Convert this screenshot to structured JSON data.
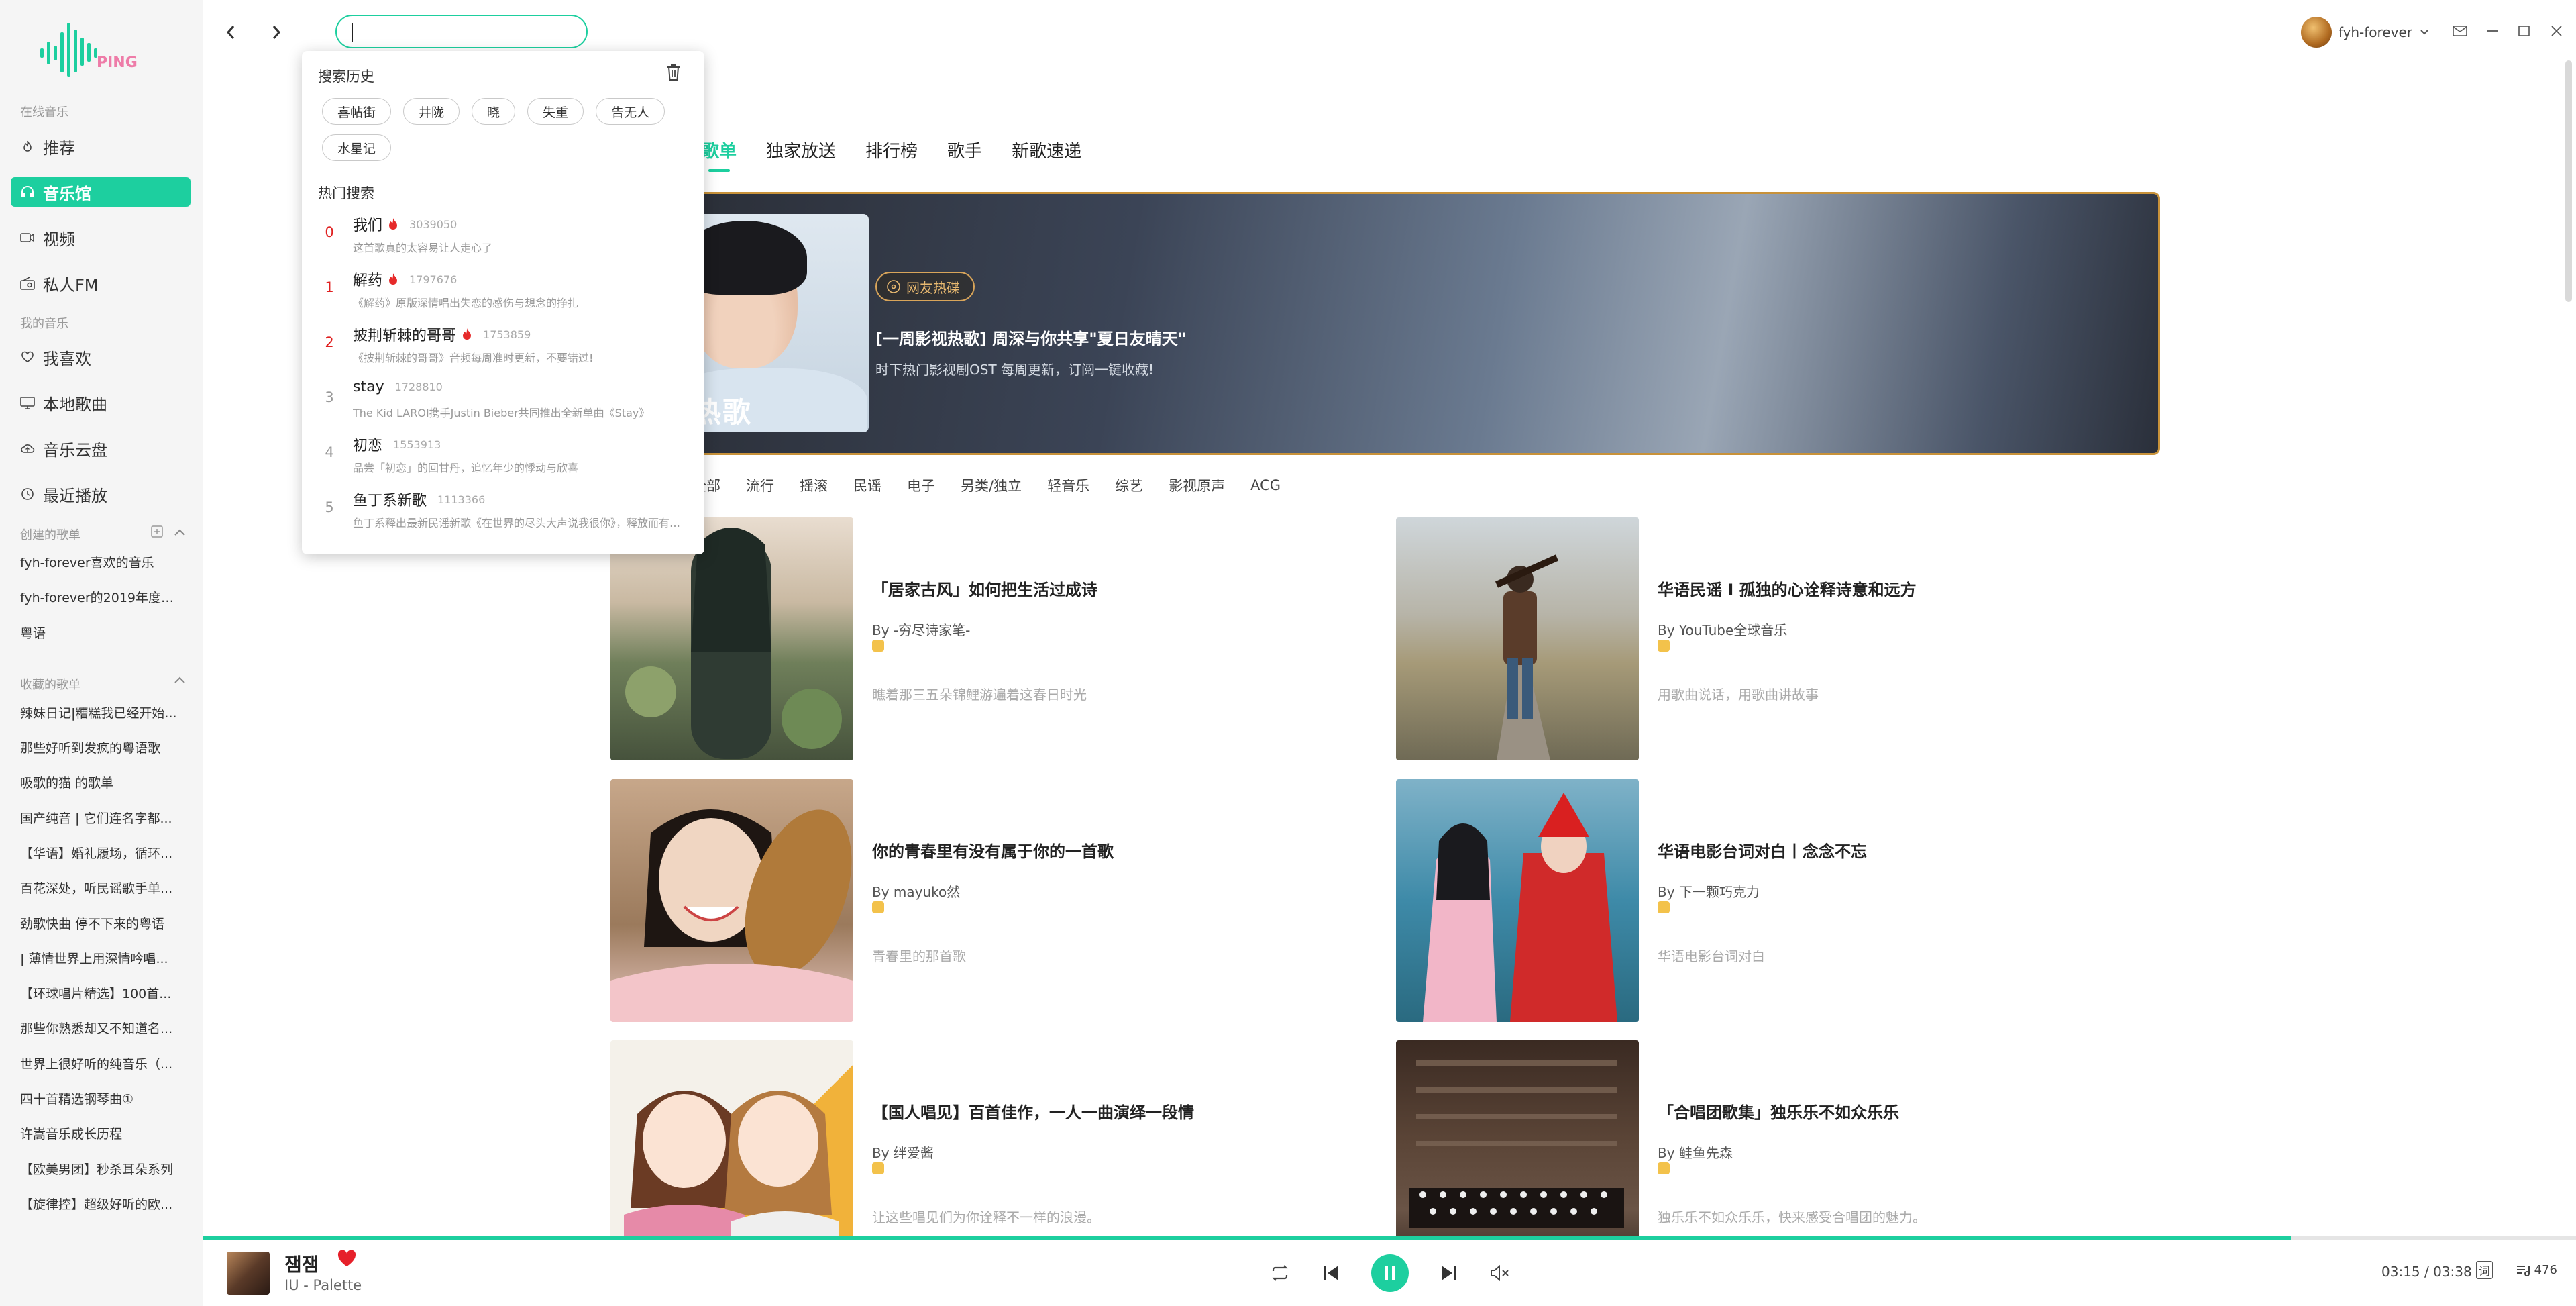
{
  "sidebar": {
    "logo_text": "PING",
    "section_online": "在线音乐",
    "online_items": [
      {
        "label": "推荐"
      },
      {
        "label": "音乐馆"
      },
      {
        "label": "视频"
      },
      {
        "label": "私人FM"
      }
    ],
    "section_mine": "我的音乐",
    "mine_items": [
      {
        "label": "我喜欢"
      },
      {
        "label": "本地歌曲"
      },
      {
        "label": "音乐云盘"
      },
      {
        "label": "最近播放"
      }
    ],
    "section_created": "创建的歌单",
    "created_lists": [
      "fyh-forever喜欢的音乐",
      "fyh-forever的2019年度歌...",
      "粤语"
    ],
    "section_collected": "收藏的歌单",
    "collected_lists": [
      "辣妹日记|糟糕我已经开始...",
      "那些好听到发疯的粤语歌",
      "吸歌的猫 的歌单",
      "国产纯音 | 它们连名字都...",
      "【华语】婚礼履场，循环...",
      "百花深处，听民谣歌手单...",
      "劲歌快曲 停不下来的粤语",
      "| 薄情世界上用深情吟唱...",
      "【环球唱片精选】100首...",
      "那些你熟悉却又不知道名...",
      "世界上很好听的纯音乐（...",
      "四十首精选钢琴曲①",
      "许嵩音乐成长历程",
      "【欧美男团】秒杀耳朵系列",
      "【旋律控】超级好听的欧..."
    ]
  },
  "topbar": {
    "search_value": "",
    "username": "fyh-forever"
  },
  "tabs": [
    "歌单",
    "独家放送",
    "排行榜",
    "歌手",
    "新歌速递"
  ],
  "banner": {
    "cover_text": "热歌",
    "badge": "网友热碟",
    "title": "[一周影视热歌] 周深与你共享\"夏日友晴天\"",
    "desc": "时下热门影视剧OST 每周更新，订阅一键收藏!"
  },
  "categories": [
    "全部",
    "流行",
    "摇滚",
    "民谣",
    "电子",
    "另类/独立",
    "轻音乐",
    "综艺",
    "影视原声",
    "ACG"
  ],
  "playlists": [
    {
      "title": "「居家古风」如何把生活过成诗",
      "author": "By -穷尽诗家笔-",
      "desc": "瞧着那三五朵锦鲤游遍着这春日时光"
    },
    {
      "title": "华语民谣 I 孤独的心诠释诗意和远方",
      "author": "By YouTube全球音乐",
      "desc": "用歌曲说话，用歌曲讲故事"
    },
    {
      "title": "你的青春里有没有属于你的一首歌",
      "author": "By mayuko然",
      "desc": "青春里的那首歌"
    },
    {
      "title": "华语电影台词对白丨念念不忘",
      "author": "By 下一颗巧克力",
      "desc": "华语电影台词对白"
    },
    {
      "title": "【国人唱见】百首佳作，一人一曲演绎一段情",
      "author": "By 绊爱酱",
      "desc": "让这些唱见们为你诠释不一样的浪漫。"
    },
    {
      "title": "「合唱团歌集」独乐乐不如众乐乐",
      "author": "By 鲑鱼先森",
      "desc": "独乐乐不如众乐乐，快来感受合唱团的魅力。"
    }
  ],
  "search_dropdown": {
    "history_title": "搜索历史",
    "history": [
      "喜帖街",
      "井陇",
      "晓",
      "失重",
      "告无人",
      "水星记"
    ],
    "hot_title": "热门搜索",
    "hot": [
      {
        "rank": "0",
        "name": "我们",
        "score": "3039050",
        "desc": "这首歌真的太容易让人走心了",
        "hot": true
      },
      {
        "rank": "1",
        "name": "解药",
        "score": "1797676",
        "desc": "《解药》原版深情唱出失恋的感伤与想念的挣扎",
        "hot": true
      },
      {
        "rank": "2",
        "name": "披荆斩棘的哥哥",
        "score": "1753859",
        "desc": "《披荆斩棘的哥哥》音频每周准时更新，不要错过!",
        "hot": true
      },
      {
        "rank": "3",
        "name": "stay",
        "score": "1728810",
        "desc": "The Kid LAROI携手Justin Bieber共同推出全新单曲《Stay》",
        "hot": false
      },
      {
        "rank": "4",
        "name": "初恋",
        "score": "1553913",
        "desc": "品尝「初恋」的回甘丹，追忆年少的悸动与欣喜",
        "hot": false
      },
      {
        "rank": "5",
        "name": "鱼丁系新歌",
        "score": "1113366",
        "desc": "鱼丁系释出最新民谣新歌《在世界的尽头大声说我很你》，释放而有色能量",
        "hot": false
      }
    ]
  },
  "player": {
    "title": "잼잼",
    "artist": "IU - Palette",
    "time": "03:15 / 03:38",
    "lyric_label": "词",
    "playlist_count": "476",
    "progress": 0.88
  },
  "colors": {
    "accent": "#1dcf9f",
    "hot": "#e02020",
    "banner_border": "#c8923a"
  }
}
